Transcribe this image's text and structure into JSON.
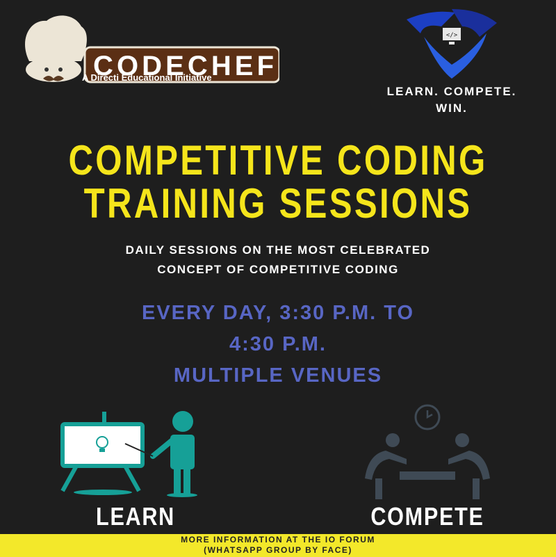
{
  "logos": {
    "codechef": {
      "name": "CODECHEF",
      "subtitle_brand": "Directi",
      "subtitle": "A Directi Educational Initiative"
    },
    "club_icon": "shield-code-monitor-icon"
  },
  "tagline": [
    "LEARN. COMPETE.",
    "WIN."
  ],
  "title": [
    "COMPETITIVE CODING",
    "TRAINING SESSIONS"
  ],
  "subtitle": [
    "DAILY SESSIONS ON THE MOST CELEBRATED",
    "CONCEPT OF COMPETITIVE CODING"
  ],
  "schedule": [
    "EVERY DAY, 3:30 P.M. TO",
    "4:30 P.M.",
    "MULTIPLE VENUES"
  ],
  "features": [
    {
      "label": "LEARN",
      "icon": "teacher-whiteboard-icon"
    },
    {
      "label": "COMPETE",
      "icon": "competitors-clock-icon"
    }
  ],
  "footer": [
    "MORE INFORMATION AT THE IO FORUM",
    "(WHATSAPP GROUP BY FACE)"
  ],
  "colors": {
    "background": "#1e1e1e",
    "title": "#f5e51b",
    "schedule": "#5866c4",
    "footer_bg": "#f3e82a",
    "learn_icon": "#16a097",
    "compete_icon": "#3f4a55"
  }
}
